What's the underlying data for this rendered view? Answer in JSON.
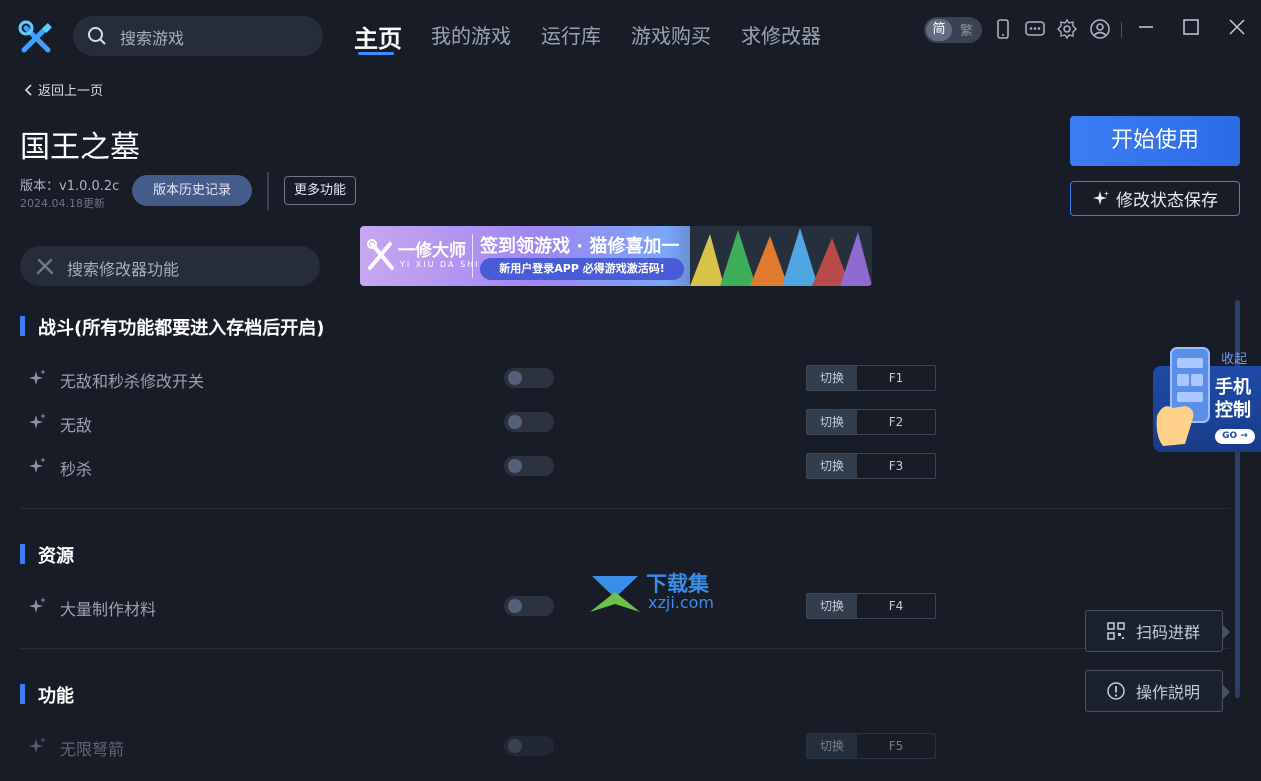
{
  "header": {
    "search_placeholder": "搜索游戏",
    "nav": [
      "主页",
      "我的游戏",
      "运行库",
      "游戏购买",
      "求修改器"
    ],
    "lang": {
      "simplified": "简",
      "traditional": "繁"
    }
  },
  "page": {
    "back_label": "返回上一页",
    "game_title": "国王之墓",
    "version": "版本：v1.0.0.2c",
    "updated": "2024.04.18更新",
    "history_button": "版本历史记录",
    "more_button": "更多功能",
    "start_button": "开始使用",
    "save_button": "修改状态保存",
    "feature_search_placeholder": "搜索修改器功能"
  },
  "banner": {
    "brand": "一修大师",
    "brand_sub": "YI XIU DA SHI",
    "headline": "签到领游戏 · 猫修喜加一",
    "pill": "新用户登录APP  必得游戏激活码!"
  },
  "sections": [
    {
      "title": "战斗(所有功能都要进入存档后开启)",
      "features": [
        {
          "name": "无敌和秒杀修改开关",
          "switch": "切换",
          "key": "F1"
        },
        {
          "name": "无敌",
          "switch": "切换",
          "key": "F2"
        },
        {
          "name": "秒杀",
          "switch": "切换",
          "key": "F3"
        }
      ]
    },
    {
      "title": "资源",
      "features": [
        {
          "name": "大量制作材料",
          "switch": "切换",
          "key": "F4"
        }
      ]
    },
    {
      "title": "功能",
      "features": [
        {
          "name": "无限弩箭",
          "switch": "切换",
          "key": "F5"
        }
      ]
    }
  ],
  "side": {
    "collapse": "收起",
    "phone_control": "手机控制",
    "go": "GO →",
    "scan_group": "扫码进群",
    "instructions": "操作説明"
  },
  "watermark": {
    "cn": "下载集",
    "url": "xzji.com"
  },
  "colors": {
    "accent": "#3f7df2",
    "background": "#171c26",
    "panel": "#262d39"
  }
}
